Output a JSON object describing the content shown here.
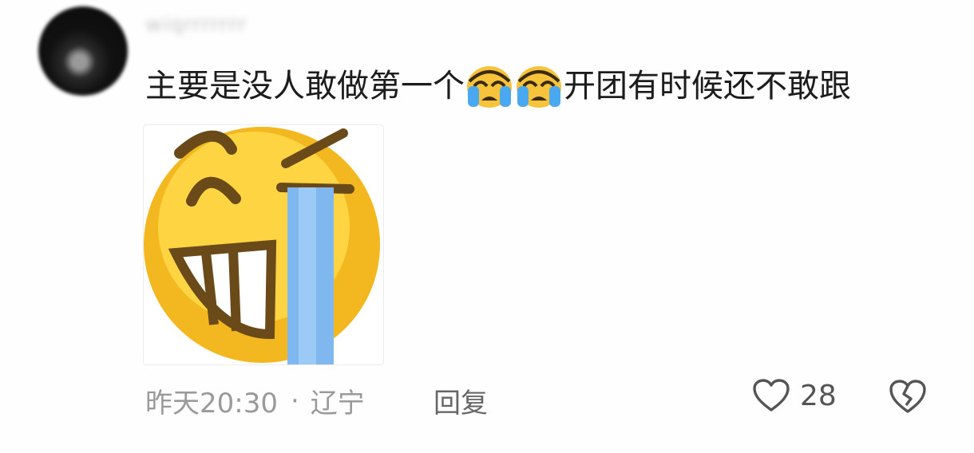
{
  "comment": {
    "username": "wiqrrrrrrr",
    "text_before": "主要是没人敢做第一个",
    "emojis": [
      "crying-face-icon",
      "crying-face-icon"
    ],
    "text_after": "开团有时候还不敢跟",
    "time": "昨天20:30",
    "separator": "·",
    "location": "辽宁",
    "reply_label": "回复",
    "like_count": "28"
  }
}
